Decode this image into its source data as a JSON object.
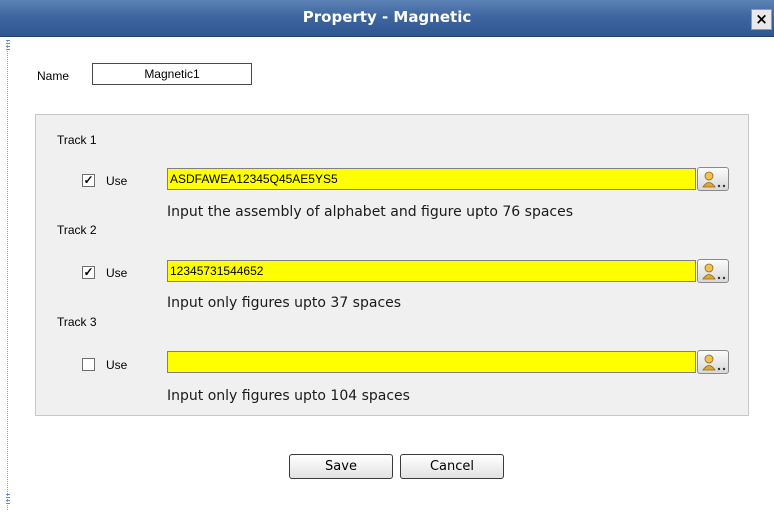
{
  "window": {
    "title": "Property - Magnetic",
    "close_label": "×"
  },
  "name": {
    "label": "Name",
    "value": "Magnetic1"
  },
  "tracks": [
    {
      "label": "Track 1",
      "use_label": "Use",
      "checked": true,
      "check_mark": "✓",
      "value": "ASDFAWEA12345Q45AE5YS5",
      "hint": "Input the assembly of alphabet and figure upto 76 spaces"
    },
    {
      "label": "Track 2",
      "use_label": "Use",
      "checked": true,
      "check_mark": "✓",
      "value": "12345731544652",
      "hint": "Input only figures upto 37 spaces"
    },
    {
      "label": "Track 3",
      "use_label": "Use",
      "checked": false,
      "check_mark": "",
      "value": "",
      "hint": "Input only figures upto 104 spaces"
    }
  ],
  "buttons": {
    "save": "Save",
    "cancel": "Cancel"
  },
  "colors": {
    "titlebar": "#3f66a0",
    "field_bg": "#ffff00",
    "group_bg": "#f0f0f0"
  },
  "icons": {
    "browse": "person-browse-icon"
  }
}
